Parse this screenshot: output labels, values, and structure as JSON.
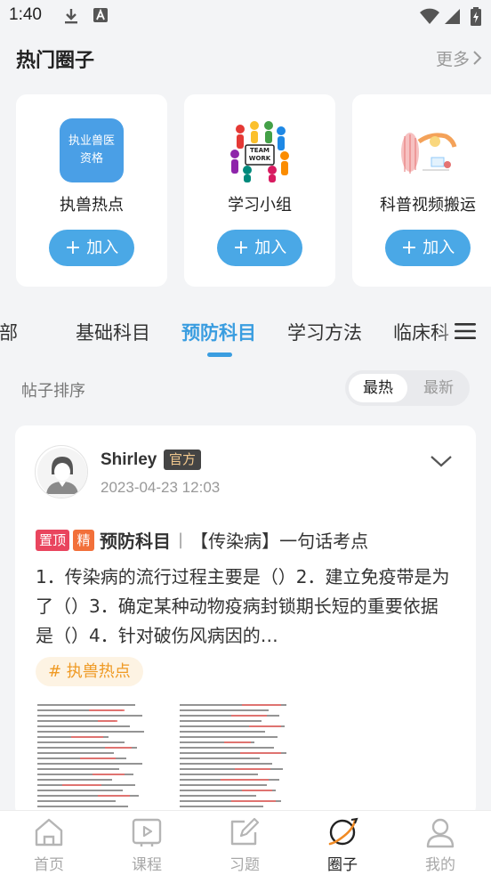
{
  "status_bar": {
    "time": "1:40"
  },
  "hot_circles": {
    "title": "热门圈子",
    "more_label": "更多",
    "join_label": "加入",
    "items": [
      {
        "name": "执兽热点",
        "thumb_text_1": "执业兽医",
        "thumb_text_2": "资格"
      },
      {
        "name": "学习小组",
        "thumb_text_1": "TEAM",
        "thumb_text_2": "WORK"
      },
      {
        "name": "科普视频搬运"
      }
    ]
  },
  "category_tabs": {
    "items": [
      "全部",
      "基础科目",
      "预防科目",
      "学习方法",
      "临床科"
    ],
    "active_index": 2
  },
  "sort": {
    "label": "帖子排序",
    "options": [
      "最热",
      "最新"
    ],
    "selected": "最热"
  },
  "post": {
    "author": "Shirley",
    "author_badge": "官方",
    "time": "2023-04-23 12:03",
    "tag_top": "置顶",
    "tag_featured": "精",
    "topic": "预防科目",
    "separator": "|",
    "title": "【传染病】一句话考点",
    "body": "1．传染病的流行过程主要是（）2．建立免疫带是为了（）3．确定某种动物疫病封锁期长短的重要依据是（）4．针对破伤风病因的…",
    "hashtag": "# 执兽热点"
  },
  "bottom_nav": {
    "items": [
      "首页",
      "课程",
      "习题",
      "圈子",
      "我的"
    ],
    "active_index": 3
  },
  "colors": {
    "accent": "#3a9de0",
    "join_button": "#4aa8e6",
    "tag_top": "#e9455e",
    "tag_featured": "#f2703a",
    "hashtag_text": "#ef9a24",
    "hashtag_bg": "#fdf3e3",
    "official_badge_bg": "#444444",
    "official_badge_text": "#f2c98f"
  }
}
